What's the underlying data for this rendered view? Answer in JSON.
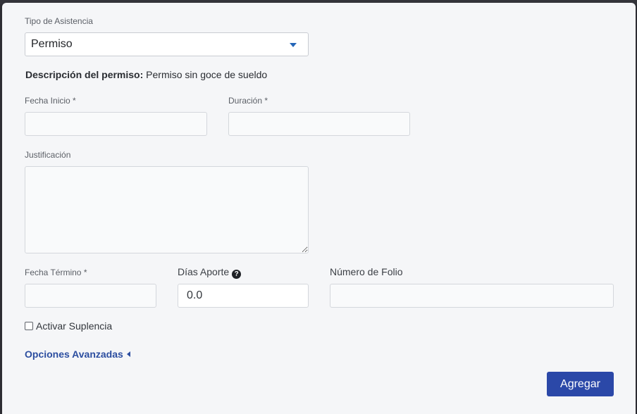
{
  "form": {
    "tipo_label": "Tipo de Asistencia",
    "tipo_value": "Permiso",
    "descripcion_label": "Descripción del permiso:",
    "descripcion_value": "Permiso sin goce de sueldo",
    "fecha_inicio_label": "Fecha Inicio *",
    "fecha_inicio_value": "",
    "duracion_label": "Duración *",
    "duracion_value": "",
    "justificacion_label": "Justificación",
    "justificacion_value": "",
    "fecha_termino_label": "Fecha Término *",
    "fecha_termino_value": "",
    "dias_aporte_label": "Días Aporte",
    "dias_aporte_value": "0.0",
    "folio_label": "Número de Folio",
    "folio_value": "",
    "suplencia_label": "Activar Suplencia",
    "opciones_label": "Opciones Avanzadas",
    "submit_label": "Agregar"
  },
  "icons": {
    "help": "question-circle-icon",
    "caret": "chevron-down-icon",
    "advanced": "caret-left-icon"
  },
  "colors": {
    "primary": "#2b48a8",
    "link": "#2c4ea0",
    "caret": "#2466b8"
  }
}
